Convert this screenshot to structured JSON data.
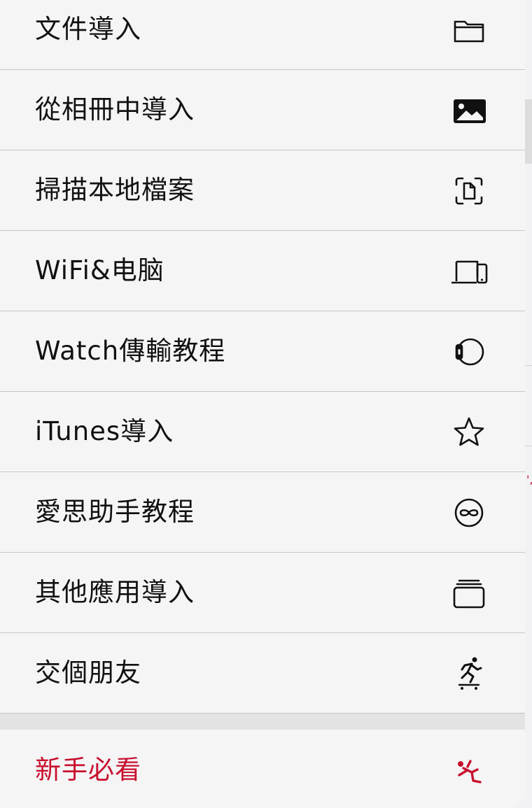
{
  "menu": {
    "items": [
      {
        "label": "文件導入",
        "icon": "folder-icon"
      },
      {
        "label": "從相冊中導入",
        "icon": "photo-icon"
      },
      {
        "label": "掃描本地檔案",
        "icon": "doc-scan-icon"
      },
      {
        "label": "WiFi&电脑",
        "icon": "laptop-phone-icon"
      },
      {
        "label": "Watch傳輸教程",
        "icon": "watch-icon"
      },
      {
        "label": "iTunes導入",
        "icon": "star-icon"
      },
      {
        "label": "愛思助手教程",
        "icon": "infinity-icon"
      },
      {
        "label": "其他應用導入",
        "icon": "stack-icon"
      },
      {
        "label": "交個朋友",
        "icon": "skateboarder-icon"
      }
    ],
    "footer_item": {
      "label": "新手必看",
      "icon": "falling-person-icon"
    }
  },
  "colors": {
    "text": "#111111",
    "accent_red": "#c8102e",
    "separator": "#c6c6c8",
    "sheet": "#f5f5f5"
  }
}
